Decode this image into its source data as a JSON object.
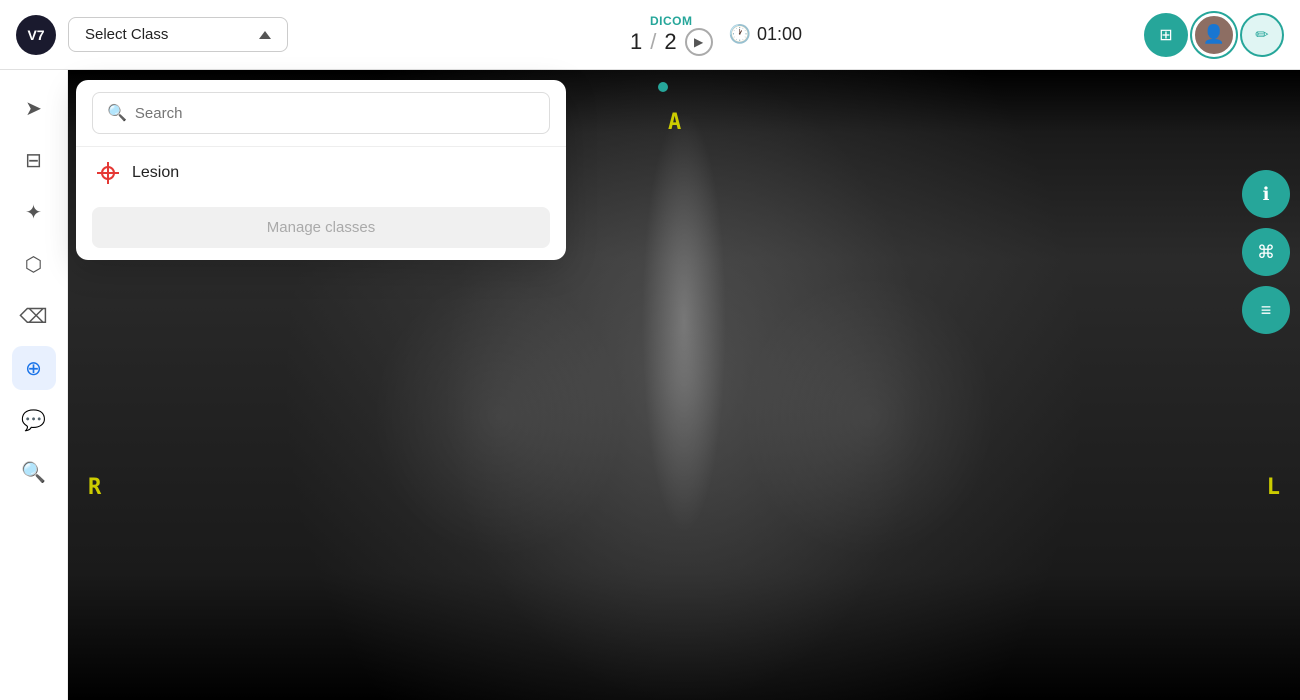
{
  "header": {
    "logo_text": "V7",
    "class_selector_label": "Select Class",
    "dicom_label": "DICOM",
    "current_page": "1",
    "separator": "/",
    "total_pages": "2",
    "timer": "01:00",
    "manage_classes_btn": "Manage classes"
  },
  "search": {
    "placeholder": "Search"
  },
  "dropdown": {
    "items": [
      {
        "label": "Lesion",
        "icon": "crosshair-icon"
      }
    ]
  },
  "xray_labels": {
    "A": "A",
    "R": "R",
    "L": "L"
  },
  "sidebar": {
    "icons": [
      {
        "name": "send-icon",
        "symbol": "➤"
      },
      {
        "name": "minus-square-icon",
        "symbol": "⊟"
      },
      {
        "name": "sparkle-icon",
        "symbol": "✦"
      },
      {
        "name": "polygon-icon",
        "symbol": "⬡"
      },
      {
        "name": "eraser-icon",
        "symbol": "⌫"
      },
      {
        "name": "crosshair-tool-icon",
        "symbol": "⊕",
        "active": true
      },
      {
        "name": "comment-icon",
        "symbol": "💬"
      },
      {
        "name": "search-tool-icon",
        "symbol": "🔍"
      }
    ]
  },
  "right_panel": {
    "buttons": [
      {
        "name": "info-icon",
        "symbol": "ℹ"
      },
      {
        "name": "keyboard-icon",
        "symbol": "⌘"
      },
      {
        "name": "layers-icon",
        "symbol": "≡"
      }
    ]
  },
  "colors": {
    "teal": "#26a69a",
    "active_blue": "#1a73e8",
    "lesion_red": "#e53935",
    "logo_dark": "#1a1a2e",
    "yellow_label": "#cccc00"
  }
}
